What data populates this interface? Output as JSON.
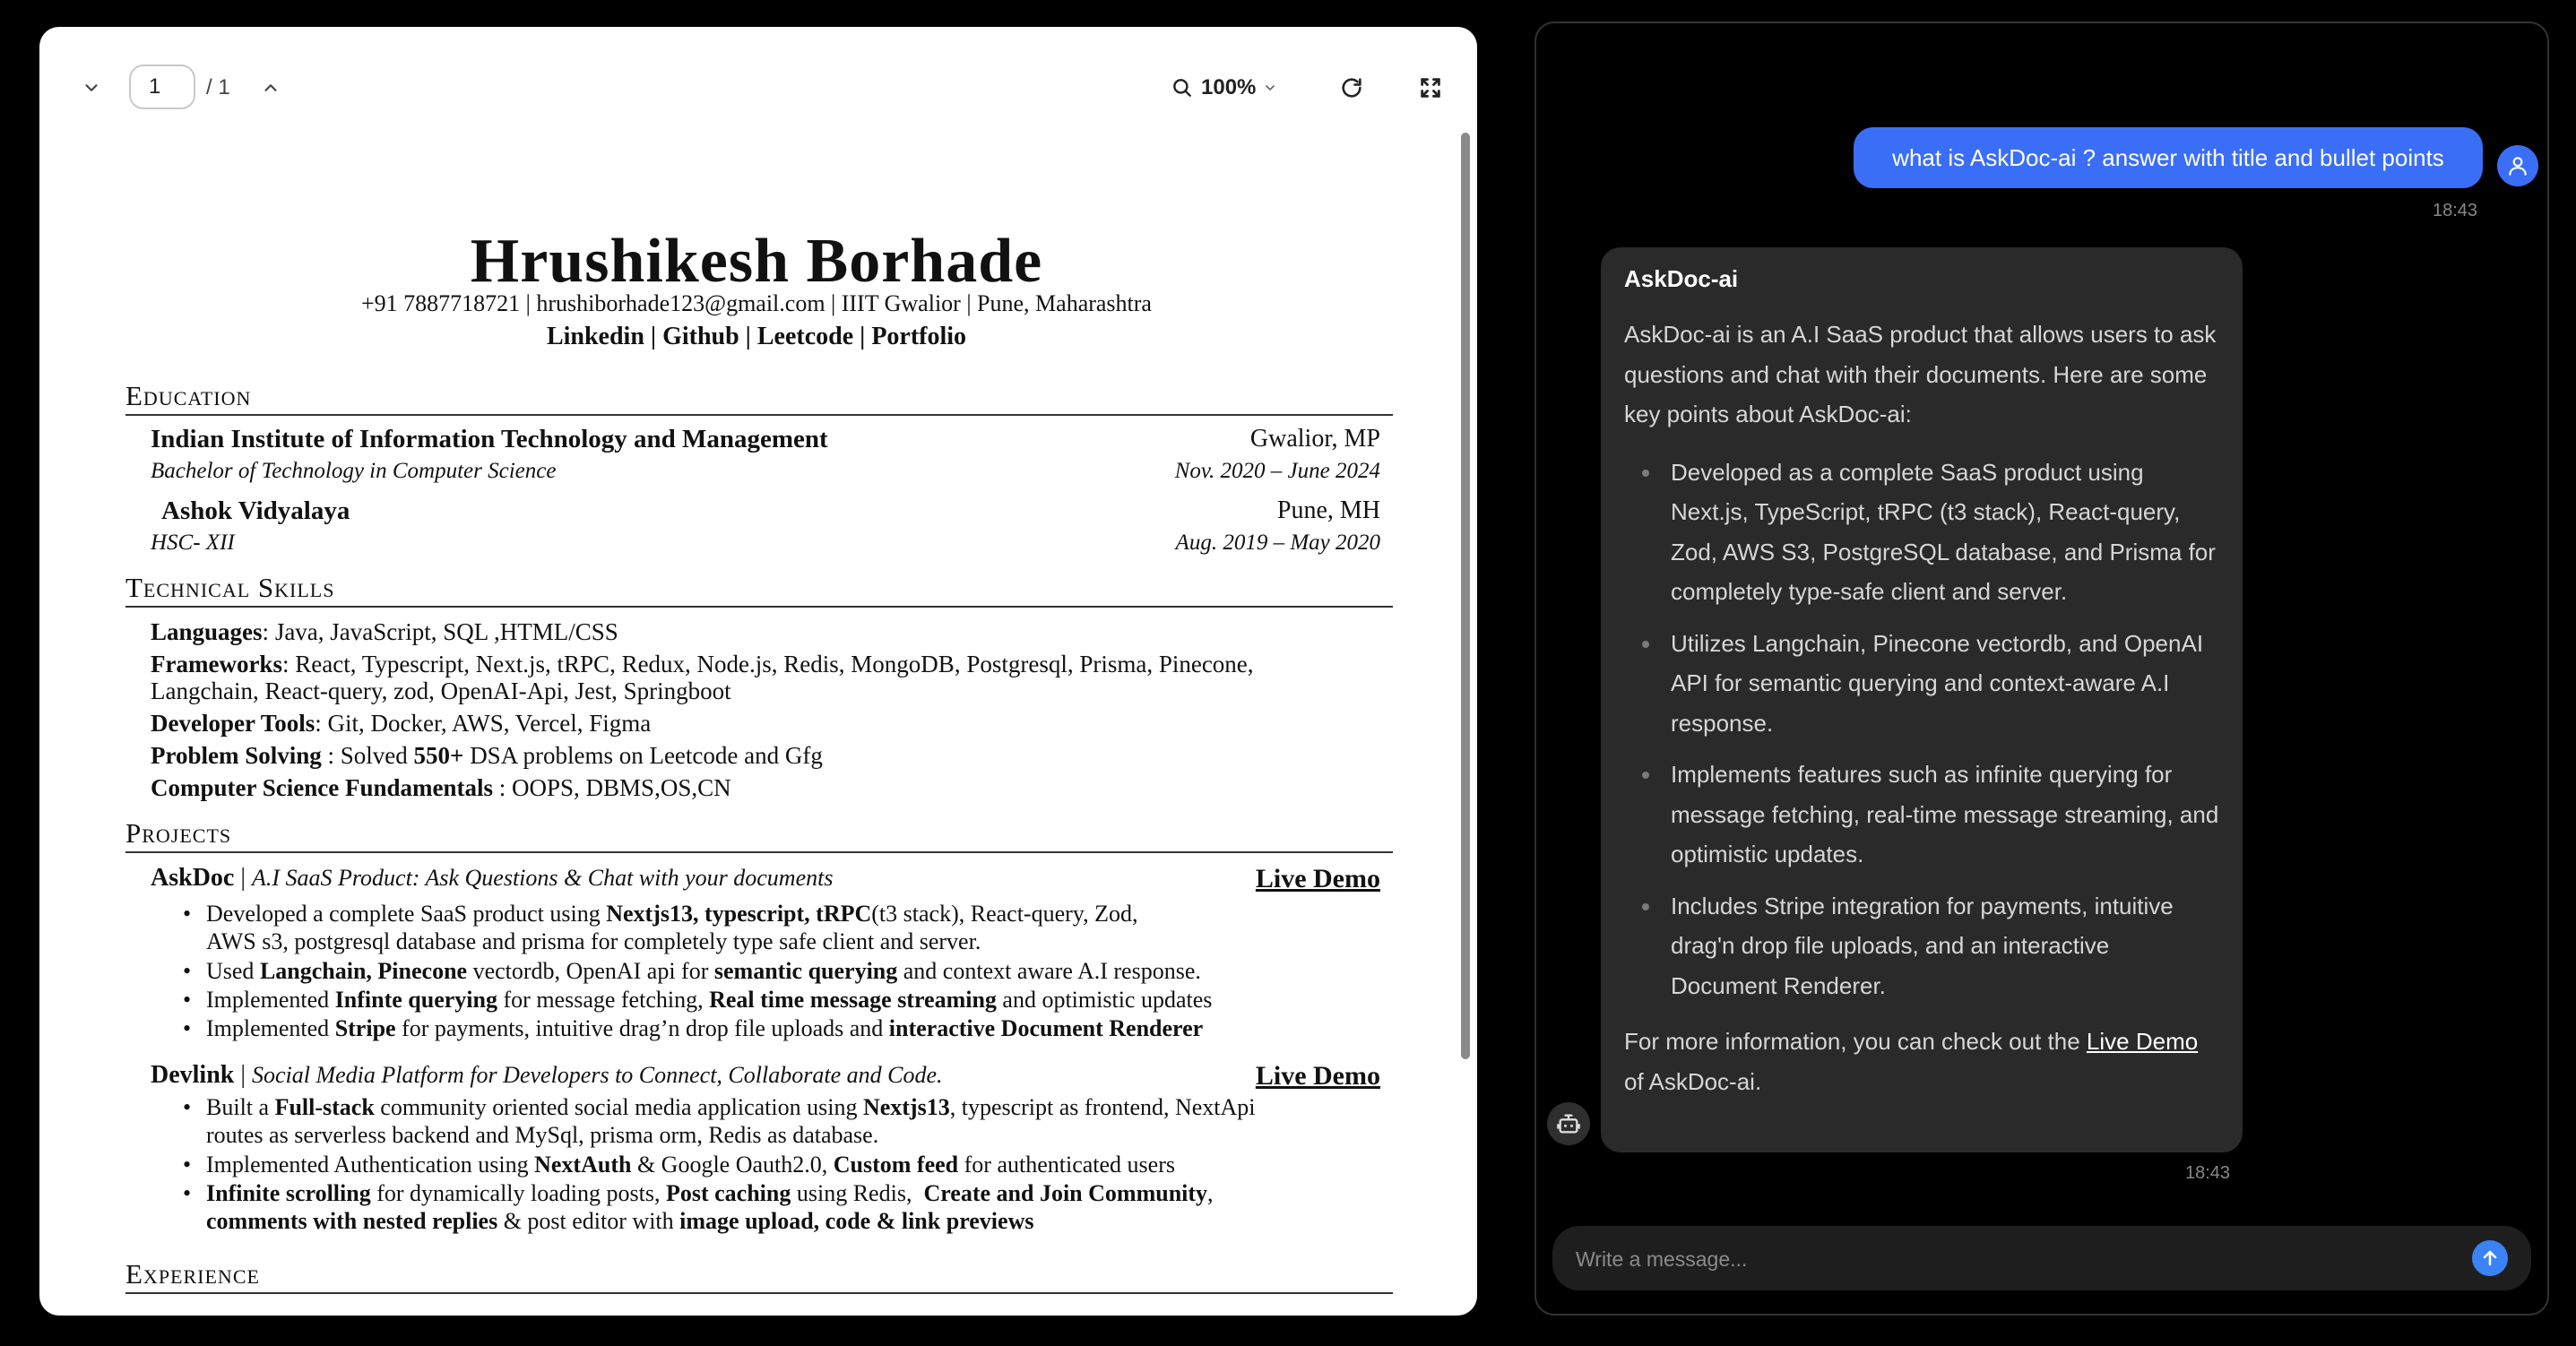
{
  "viewer": {
    "page_current": "1",
    "page_total": "/ 1",
    "zoom": "100%"
  },
  "resume": {
    "name": "Hrushikesh Borhade",
    "contact": "+91 7887718721 | hrushiborhade123@gmail.com | IIIT Gwalior | Pune, Maharashtra",
    "links": [
      "Linkedin",
      "Github",
      "Leetcode",
      "Portfolio"
    ],
    "link_sep": " | ",
    "sections": {
      "education": "Education",
      "skills": "Technical Skills",
      "projects": "Projects",
      "experience": "Experience"
    },
    "education": [
      {
        "school": "Indian Institute of Information Technology and Management",
        "location": "Gwalior, MP",
        "degree": "Bachelor of Technology in Computer Science",
        "dates": "Nov. 2020 – June 2024"
      },
      {
        "school": "Ashok Vidyalaya",
        "location": "Pune, MH",
        "degree": "HSC- XII",
        "dates": "Aug. 2019 – May 2020"
      }
    ],
    "skills": [
      {
        "label": "Languages",
        "sep": ": ",
        "text": "Java, JavaScript, SQL ,HTML/CSS"
      },
      {
        "label": "Frameworks",
        "sep": ": ",
        "text": "React, Typescript, Next.js, tRPC, Redux, Node.js, Redis, MongoDB, Postgresql, Prisma, Pinecone,",
        "text2": "Langchain, React-query, zod, OpenAI-Api, Jest, Springboot"
      },
      {
        "label": "Developer Tools",
        "sep": ": ",
        "text": "Git, Docker, AWS, Vercel, Figma"
      },
      {
        "label": "Problem Solving",
        "sep": " : Solved ",
        "bold_num": "550+",
        "text": " DSA problems on Leetcode and Gfg"
      },
      {
        "label": "Computer Science Fundamentals",
        "sep": " : ",
        "text": "OOPS, DBMS,OS,CN"
      }
    ],
    "projects": [
      {
        "name": "AskDoc",
        "tagline": "A.I SaaS Product: Ask Questions & Chat with your documents",
        "demo": "Live Demo",
        "b1": {
          "t1": "Developed a complete SaaS product using ",
          "b1": "Nextjs13, typescript, tRPC",
          "t2": "(t3 stack), React-query, Zod,",
          "t3": "AWS s3, postgresql database and prisma for completely type safe client and server."
        },
        "b2": {
          "t1": "Used ",
          "b1": "Langchain, Pinecone",
          "t2": " vectordb, OpenAI api for ",
          "b2": "semantic querying",
          "t3": " and context aware A.I response."
        },
        "b3": {
          "t1": "Implemented ",
          "b1": "Infinte querying",
          "t2": " for message fetching, ",
          "b2": "Real time message streaming",
          "t3": " and optimistic updates"
        },
        "b4": {
          "t1": "Implemented ",
          "b1": "Stripe",
          "t2": " for payments, intuitive drag’n drop file uploads and ",
          "b2": "interactive Document Renderer"
        }
      },
      {
        "name": "Devlink",
        "tagline": "Social Media Platform for Developers to Connect, Collaborate and Code.",
        "demo": "Live Demo",
        "b1": {
          "t1": "Built a ",
          "b1": "Full-stack",
          "t2": " community oriented social media application using ",
          "b2": "Nextjs13",
          "t3": ", typescript as frontend, NextApi",
          "t4": "routes as serverless backend and MySql, prisma orm, Redis as database."
        },
        "b2": {
          "t1": "Implemented Authentication using ",
          "b1": "NextAuth",
          "t2": " & Google Oauth2.0, ",
          "b2": "Custom feed",
          "t3": " for authenticated users"
        },
        "b3": {
          "b1": "Infinite scrolling",
          "t1": " for dynamically loading posts, ",
          "b2": "Post caching",
          "t2": " using Redis,  ",
          "b3": "Create and Join Community",
          "t3": ",",
          "b4": "comments with nested replies",
          "t4": " & post editor with ",
          "b5": "image upload, code & link previews"
        }
      }
    ]
  },
  "chat": {
    "user_message": "what is AskDoc-ai ? answer with title and bullet points",
    "user_time": "18:43",
    "ai_title": "AskDoc-ai",
    "ai_intro": "AskDoc-ai is an A.I SaaS product that allows users to ask questions and chat with their documents. Here are some key points about AskDoc-ai:",
    "ai_points": [
      "Developed as a complete SaaS product using Next.js, TypeScript, tRPC (t3 stack), React-query, Zod, AWS S3, PostgreSQL database, and Prisma for completely type-safe client and server.",
      "Utilizes Langchain, Pinecone vectordb, and OpenAI API for semantic querying and context-aware A.I response.",
      "Implements features such as infinite querying for message fetching, real-time message streaming, and optimistic updates.",
      "Includes Stripe integration for payments, intuitive drag'n drop file uploads, and an interactive Document Renderer."
    ],
    "ai_outro_pre": "For more information, you can check out the ",
    "ai_outro_link": "Live Demo",
    "ai_outro_post": " of AskDoc-ai.",
    "ai_time": "18:43",
    "composer_placeholder": "Write a message...",
    "colors": {
      "accent": "#3b6ef6",
      "bubble": "#2a2a2b",
      "background": "#000000"
    }
  }
}
